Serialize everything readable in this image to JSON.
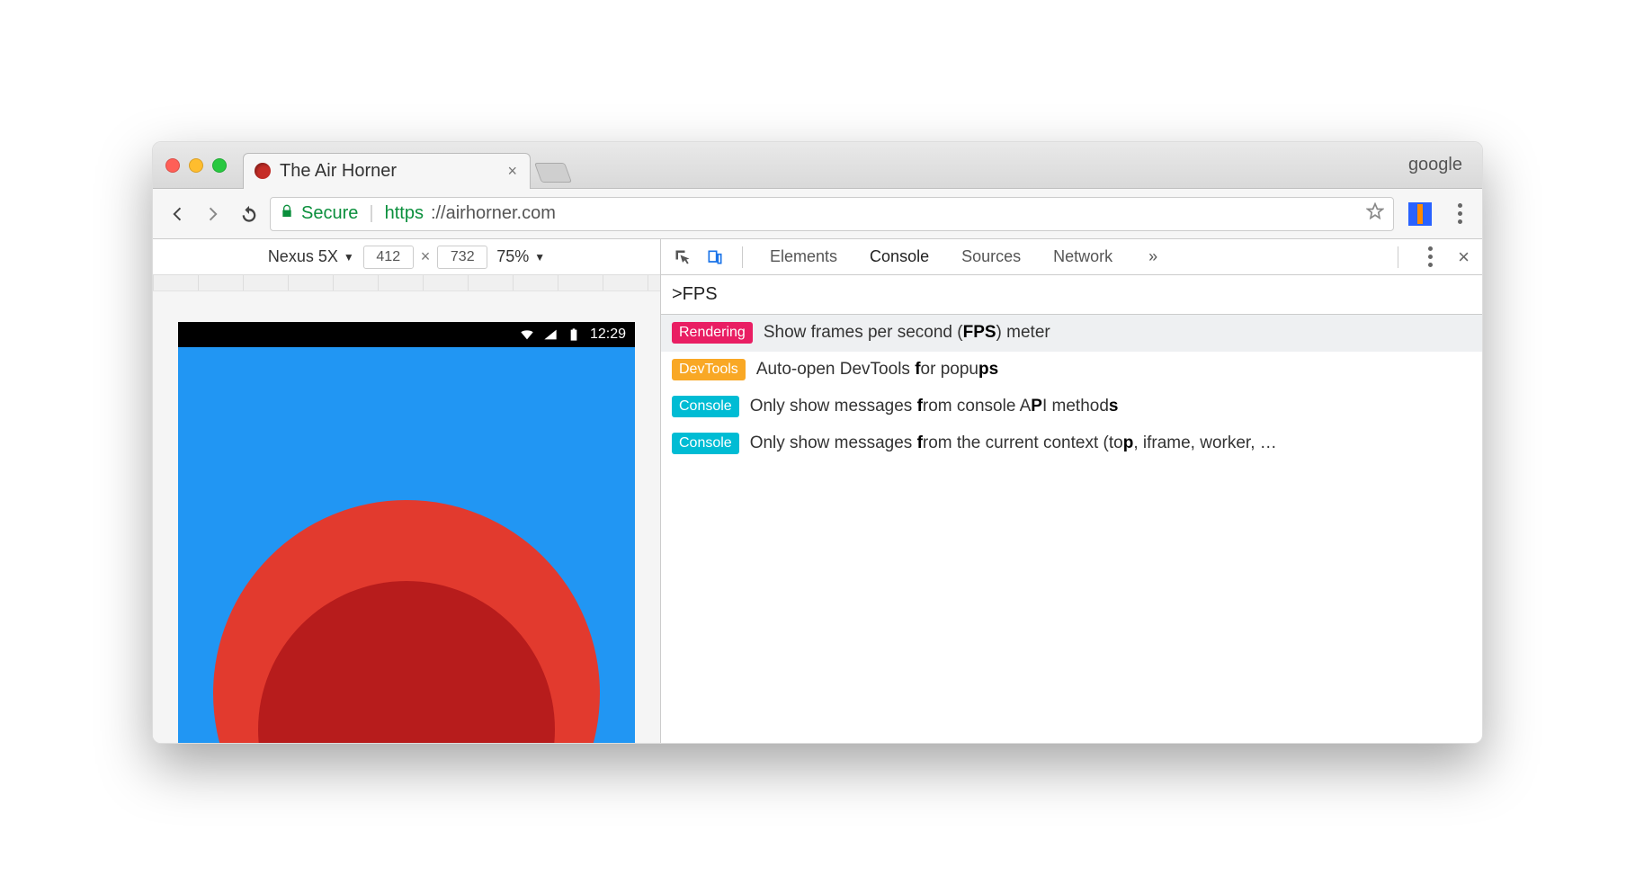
{
  "window": {
    "tab_title": "The Air Horner",
    "profile": "google"
  },
  "omnibox": {
    "secure_label": "Secure",
    "scheme": "https",
    "url_display": "://airhorner.com"
  },
  "device_toolbar": {
    "device": "Nexus 5X",
    "width": "412",
    "height": "732",
    "zoom": "75%"
  },
  "phone_status": {
    "time": "12:29"
  },
  "devtools": {
    "tabs": [
      "Elements",
      "Console",
      "Sources",
      "Network"
    ],
    "active_tab": "Console",
    "more": "»",
    "command_input": ">FPS",
    "results": [
      {
        "badge": "Rendering",
        "badge_class": "b-rend",
        "text_pre": "Show frames per second (",
        "bold": "FPS",
        "text_post": ") meter",
        "selected": true
      },
      {
        "badge": "DevTools",
        "badge_class": "b-dev",
        "text_pre": "Auto-open DevTools ",
        "bold": "f",
        "text_post": "or popu",
        "bold2": "ps",
        "tail": ""
      },
      {
        "badge": "Console",
        "badge_class": "b-con",
        "text_pre": "Only show messages ",
        "bold": "f",
        "text_post": "rom console A",
        "bold2": "P",
        "tail": "I method",
        "bold3": "s"
      },
      {
        "badge": "Console",
        "badge_class": "b-con",
        "text_pre": "Only show messages ",
        "bold": "f",
        "text_post": "rom the current context (to",
        "bold2": "p",
        "tail": ", iframe, worker, …"
      }
    ]
  }
}
